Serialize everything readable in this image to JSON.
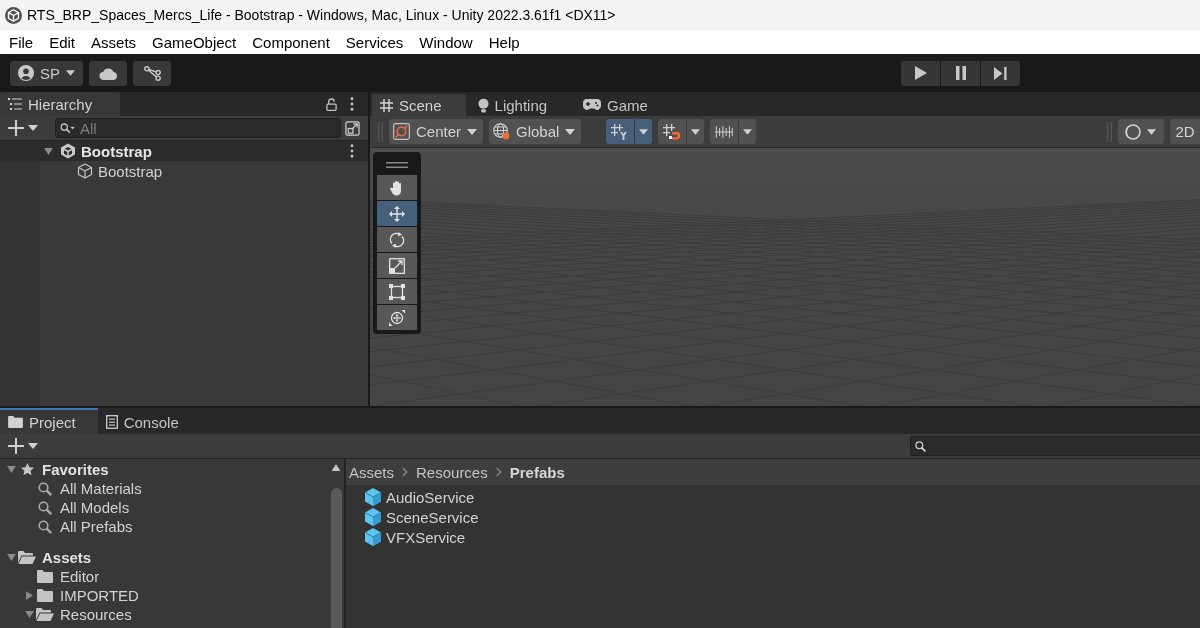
{
  "window": {
    "title": "RTS_BRP_Spaces_Mercs_Life - Bootstrap - Windows, Mac, Linux - Unity 2022.3.61f1 <DX11>"
  },
  "menu_bar": [
    "File",
    "Edit",
    "Assets",
    "GameObject",
    "Component",
    "Services",
    "Window",
    "Help"
  ],
  "main_toolbar": {
    "account": "SP"
  },
  "hierarchy": {
    "tabs": [
      {
        "label": "Hierarchy",
        "kind": "hierarchy",
        "selected": true
      }
    ],
    "search": {
      "placeholder": "All"
    },
    "tree": [
      {
        "label": "Bootstrap",
        "kind": "scene",
        "expanded": true,
        "children": [
          {
            "label": "Bootstrap",
            "kind": "object"
          }
        ]
      }
    ]
  },
  "scene_panel": {
    "tabs": [
      {
        "label": "Scene",
        "kind": "scene",
        "selected": true
      },
      {
        "label": "Lighting",
        "kind": "lighting",
        "selected": false
      },
      {
        "label": "Game",
        "kind": "game",
        "selected": false
      }
    ],
    "toolbar": {
      "pivot_mode": "Center",
      "pivot_rotation": "Global",
      "toggles": [
        {
          "kind": "grid",
          "on": true
        },
        {
          "kind": "snap",
          "on": false
        },
        {
          "kind": "increment",
          "on": false
        }
      ],
      "view_mode": "2D"
    },
    "tools": [
      {
        "kind": "hand",
        "selected": false
      },
      {
        "kind": "move",
        "selected": true
      },
      {
        "kind": "rotate",
        "selected": false
      },
      {
        "kind": "scale",
        "selected": false
      },
      {
        "kind": "rect",
        "selected": false
      },
      {
        "kind": "transform",
        "selected": false
      }
    ]
  },
  "project_panel": {
    "tabs": [
      {
        "label": "Project",
        "kind": "project",
        "selected": true
      },
      {
        "label": "Console",
        "kind": "console",
        "selected": false
      }
    ],
    "tree": [
      {
        "label": "Favorites",
        "kind": "favorites",
        "expanded": true,
        "children": [
          {
            "label": "All Materials",
            "kind": "search"
          },
          {
            "label": "All Models",
            "kind": "search"
          },
          {
            "label": "All Prefabs",
            "kind": "search"
          }
        ]
      },
      {
        "label": "Assets",
        "kind": "folder",
        "expanded": true,
        "children": [
          {
            "label": "Editor",
            "kind": "folder"
          },
          {
            "label": "IMPORTED",
            "kind": "folder",
            "expanded": false
          },
          {
            "label": "Resources",
            "kind": "folder",
            "expanded": true
          }
        ]
      }
    ],
    "breadcrumb": [
      "Assets",
      "Resources",
      "Prefabs"
    ],
    "assets": [
      "AudioService",
      "SceneService",
      "VFXService"
    ]
  }
}
